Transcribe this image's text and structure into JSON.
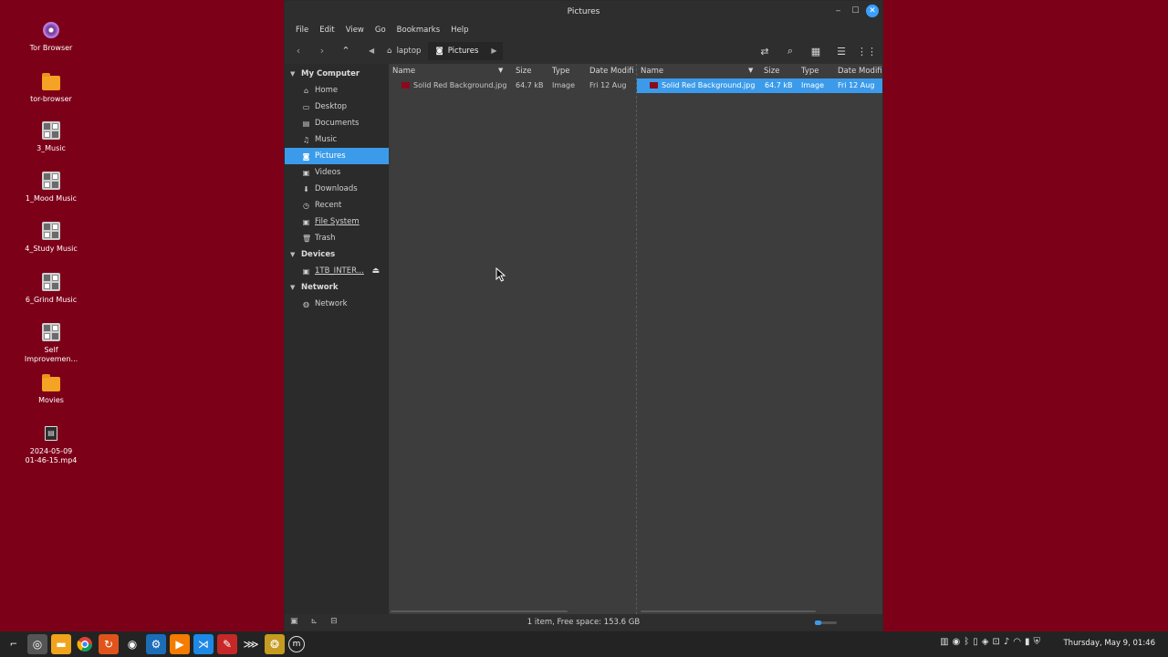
{
  "desktop": {
    "icons": [
      {
        "label": "Tor Browser",
        "icon": "tor-browser-icon"
      },
      {
        "label": "tor-browser",
        "icon": "folder-icon"
      },
      {
        "label": "3_Music",
        "icon": "app-icon"
      },
      {
        "label": "1_Mood Music",
        "icon": "app-icon"
      },
      {
        "label": "4_Study Music",
        "icon": "app-icon"
      },
      {
        "label": "6_Grind Music",
        "icon": "app-icon"
      },
      {
        "label": "Self Improvemen...",
        "icon": "app-icon"
      },
      {
        "label": "Movies",
        "icon": "folder-icon"
      },
      {
        "label": "2024-05-09 01-46-15.mp4",
        "icon": "video-file-icon"
      }
    ]
  },
  "window": {
    "title": "Pictures",
    "menu": [
      "File",
      "Edit",
      "View",
      "Go",
      "Bookmarks",
      "Help"
    ],
    "breadcrumbs": {
      "parent": "laptop",
      "current": "Pictures"
    },
    "sidebar": {
      "sections": [
        {
          "title": "My Computer",
          "items": [
            {
              "label": "Home",
              "icon": "home-icon"
            },
            {
              "label": "Desktop",
              "icon": "desktop-icon"
            },
            {
              "label": "Documents",
              "icon": "documents-icon"
            },
            {
              "label": "Music",
              "icon": "music-icon"
            },
            {
              "label": "Pictures",
              "icon": "pictures-icon",
              "selected": true
            },
            {
              "label": "Videos",
              "icon": "videos-icon"
            },
            {
              "label": "Downloads",
              "icon": "downloads-icon"
            },
            {
              "label": "Recent",
              "icon": "recent-icon"
            },
            {
              "label": "File System",
              "icon": "filesystem-icon"
            },
            {
              "label": "Trash",
              "icon": "trash-icon"
            }
          ]
        },
        {
          "title": "Devices",
          "items": [
            {
              "label": "1TB_INTER...",
              "icon": "drive-icon"
            }
          ]
        },
        {
          "title": "Network",
          "items": [
            {
              "label": "Network",
              "icon": "network-icon"
            }
          ]
        }
      ]
    },
    "columns": [
      "Name",
      "Size",
      "Type",
      "Date Modifi"
    ],
    "left_pane": {
      "rows": [
        {
          "name": "Solid Red Background.jpg",
          "size": "64.7 kB",
          "type": "Image",
          "date": "Fri 12 Aug"
        }
      ]
    },
    "right_pane": {
      "rows": [
        {
          "name": "Solid Red Background.jpg",
          "size": "64.7 kB",
          "type": "Image",
          "date": "Fri 12 Aug",
          "selected": true
        }
      ]
    },
    "status": "1 item, Free space: 153.6 GB"
  },
  "taskbar": {
    "clock": "Thursday, May 9, 01:46"
  },
  "colors": {
    "desktop_bg": "#7d0019",
    "accent": "#3b9bea"
  }
}
